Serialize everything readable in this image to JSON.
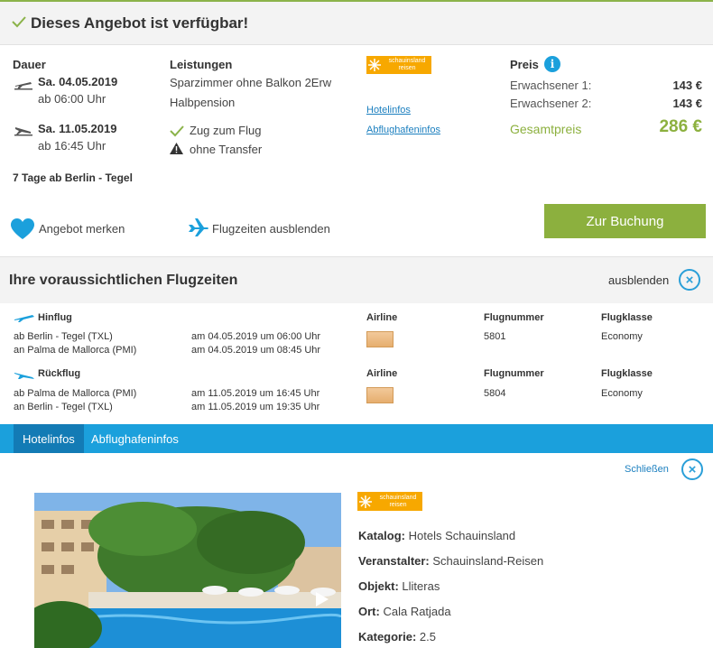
{
  "banner": {
    "title": "Dieses Angebot ist verfügbar!"
  },
  "offer": {
    "duration_label": "Dauer",
    "outbound_date": "Sa. 04.05.2019",
    "outbound_time": "ab 06:00 Uhr",
    "return_date": "Sa. 11.05.2019",
    "return_time": "ab 16:45 Uhr",
    "summary": "7 Tage ab Berlin - Tegel",
    "services_label": "Leistungen",
    "room": "Sparzimmer ohne Balkon 2Erw",
    "board": "Halbpension",
    "train": "Zug zum Flug",
    "transfer": "ohne Transfer",
    "hotel_link": "Hotelinfos",
    "airport_link": "Abflughafeninfos",
    "price_label": "Preis",
    "adult1_label": "Erwachsener 1:",
    "adult1_price": "143 €",
    "adult2_label": "Erwachsener 2:",
    "adult2_price": "143 €",
    "total_label": "Gesamtpreis",
    "total_price": "286 €",
    "remember": "Angebot merken",
    "hide_flights": "Flugzeiten ausblenden",
    "book": "Zur Buchung"
  },
  "brand": {
    "line1": "schauinsland",
    "line2": "reisen"
  },
  "flights": {
    "title": "Ihre voraussichtlichen Flugzeiten",
    "hide": "ausblenden",
    "col_airline": "Airline",
    "col_number": "Flugnummer",
    "col_class": "Flugklasse",
    "outbound": {
      "label": "Hinflug",
      "from": "ab Berlin - Tegel (TXL)",
      "to": "an Palma de Mallorca (PMI)",
      "dep": "am 04.05.2019 um 06:00 Uhr",
      "arr": "am 04.05.2019 um 08:45 Uhr",
      "number": "5801",
      "class": "Economy"
    },
    "return": {
      "label": "Rückflug",
      "from": "ab Palma de Mallorca (PMI)",
      "to": "an Berlin - Tegel (TXL)",
      "dep": "am 11.05.2019 um 16:45 Uhr",
      "arr": "am 11.05.2019 um 19:35 Uhr",
      "number": "5804",
      "class": "Economy"
    }
  },
  "tabs": {
    "hotel": "Hotelinfos",
    "airport": "Abflughafeninfos"
  },
  "hotel": {
    "close": "Schließen",
    "catalog_label": "Katalog:",
    "catalog": "Hotels Schauinsland",
    "operator_label": "Veranstalter:",
    "operator": "Schauinsland-Reisen",
    "object_label": "Objekt:",
    "object": "Lliteras",
    "place_label": "Ort:",
    "place": "Cala Ratjada",
    "category_label": "Kategorie:",
    "category": "2.5"
  },
  "colors": {
    "accent_green": "#8cb03e",
    "accent_blue": "#1ba0dc",
    "brand_orange": "#f7a800"
  }
}
